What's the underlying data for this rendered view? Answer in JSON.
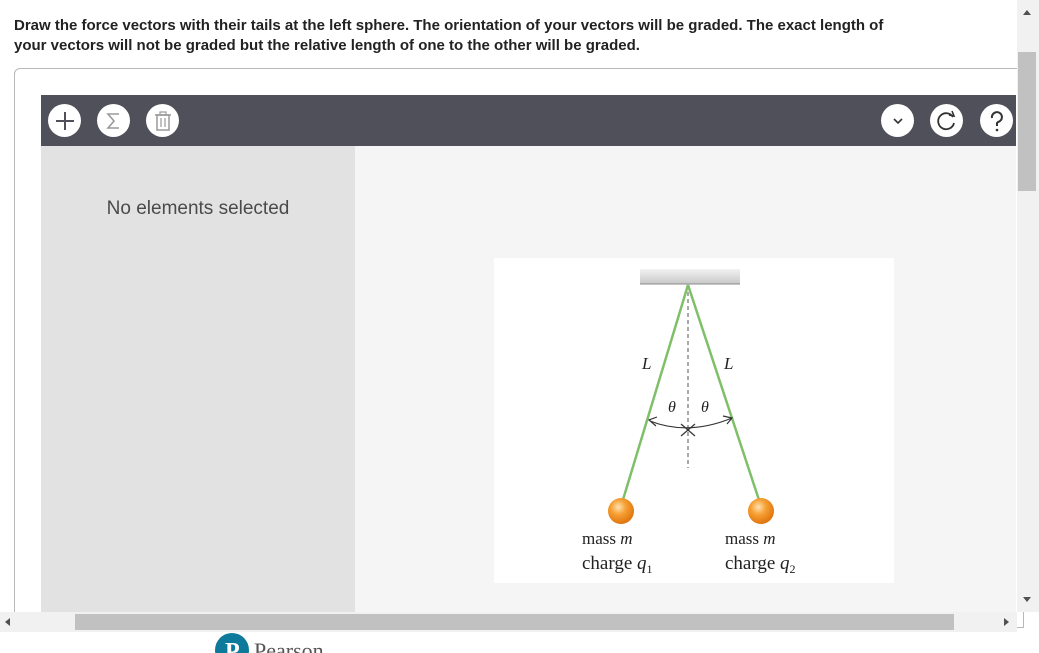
{
  "instructions": "Draw the force vectors with their tails at the left sphere. The orientation of your vectors will be graded. The exact length of your vectors will not be graded but the relative length of one to the other will be graded.",
  "toolbar": {
    "add_icon": "plus-icon",
    "sum_icon": "sigma-icon",
    "delete_icon": "trash-icon",
    "dropdown_icon": "chevron-down-icon",
    "reset_icon": "reset-icon",
    "help_icon": "help-icon"
  },
  "side_panel": {
    "message": "No elements selected"
  },
  "figure": {
    "left_length_label": "L",
    "right_length_label": "L",
    "left_angle_label": "θ",
    "right_angle_label": "θ",
    "left_mass_word": "mass ",
    "left_mass_var": "m",
    "left_charge_word": "charge ",
    "left_charge_var": "q",
    "left_charge_sub": "1",
    "right_mass_word": "mass ",
    "right_mass_var": "m",
    "right_charge_word": "charge ",
    "right_charge_var": "q",
    "right_charge_sub": "2"
  },
  "footer": {
    "brand": "Pearson"
  },
  "colors": {
    "toolbar_bg": "#4f5059",
    "string": "#7fbf6a",
    "sphere": "#f08a1c"
  }
}
